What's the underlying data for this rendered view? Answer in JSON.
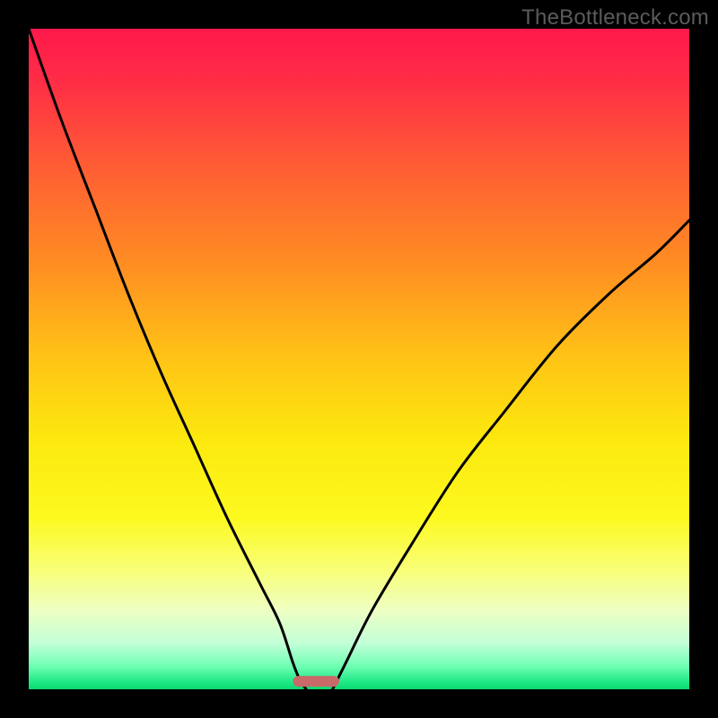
{
  "watermark": "TheBottleneck.com",
  "chart_data": {
    "type": "line",
    "title": "",
    "xlabel": "",
    "ylabel": "",
    "xlim": [
      0,
      100
    ],
    "ylim": [
      0,
      100
    ],
    "series": [
      {
        "name": "left-curve",
        "x": [
          0,
          5,
          10,
          15,
          20,
          25,
          30,
          35,
          38,
          40,
          41,
          42
        ],
        "values": [
          100,
          86,
          73,
          60,
          48,
          37,
          26,
          16,
          10,
          4,
          1.5,
          0
        ]
      },
      {
        "name": "right-curve",
        "x": [
          46,
          48,
          52,
          58,
          65,
          72,
          80,
          88,
          95,
          100
        ],
        "values": [
          0,
          4,
          12,
          22,
          33,
          42,
          52,
          60,
          66,
          71
        ]
      }
    ],
    "gradient_stops": [
      {
        "offset": 0.0,
        "color": "#ff194c"
      },
      {
        "offset": 0.08,
        "color": "#ff2d46"
      },
      {
        "offset": 0.2,
        "color": "#ff5a35"
      },
      {
        "offset": 0.35,
        "color": "#ff8b23"
      },
      {
        "offset": 0.5,
        "color": "#ffc415"
      },
      {
        "offset": 0.62,
        "color": "#fce80e"
      },
      {
        "offset": 0.74,
        "color": "#fdf91f"
      },
      {
        "offset": 0.82,
        "color": "#f8ff78"
      },
      {
        "offset": 0.88,
        "color": "#eeffc2"
      },
      {
        "offset": 0.93,
        "color": "#c3ffd8"
      },
      {
        "offset": 0.965,
        "color": "#6fffb4"
      },
      {
        "offset": 0.99,
        "color": "#1be884"
      },
      {
        "offset": 1.0,
        "color": "#0bd96f"
      }
    ],
    "marker": {
      "name": "bottleneck-marker",
      "x_start": 40,
      "x_end": 47,
      "y": 1.2,
      "color": "#c86a68"
    },
    "curve_color": "#000000",
    "curve_width": 3
  }
}
